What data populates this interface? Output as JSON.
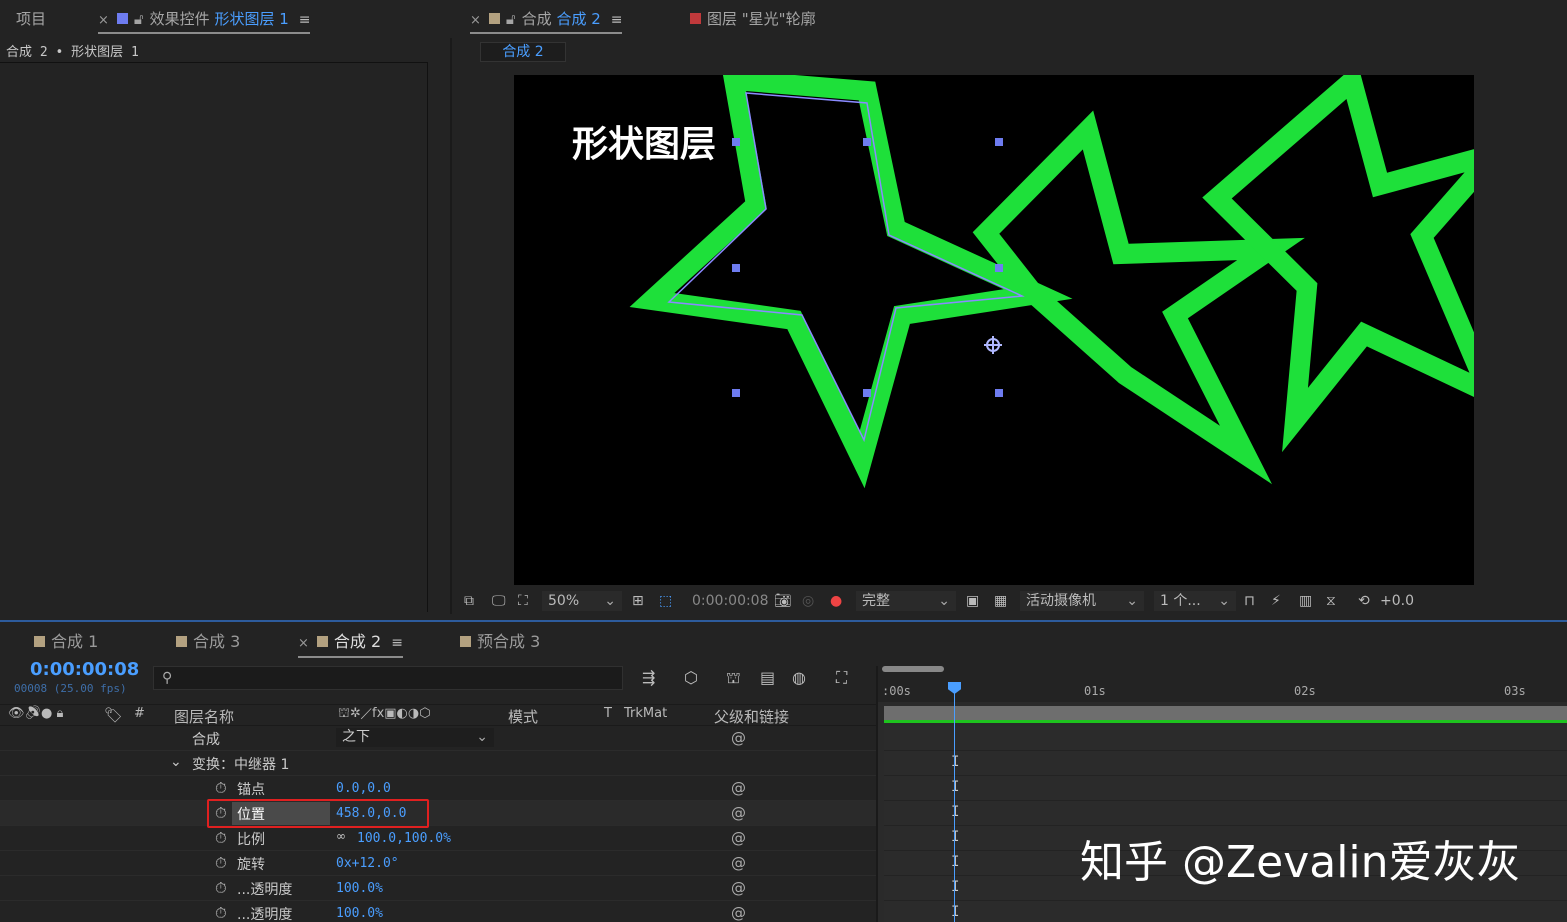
{
  "left_panel": {
    "tab_project": "项目",
    "tab_effects_prefix": "效果控件",
    "tab_effects_layer": "形状图层 1",
    "breadcrumb": "合成 2 • 形状图层 1"
  },
  "comp_panel": {
    "tab_prefix": "合成",
    "tab_comp": "合成 2",
    "tab_layer": "图层 \"星光\"轮廓",
    "subtab": "合成 2",
    "viewer_text": "形状图层"
  },
  "viewer_toolbar": {
    "zoom": "50%",
    "timecode": "0:00:00:08",
    "quality": "完整",
    "camera": "活动摄像机",
    "views": "1 个...",
    "exposure": "+0.0"
  },
  "timeline": {
    "tabs": [
      "合成 1",
      "合成 3",
      "合成 2",
      "预合成 3"
    ],
    "time": "0:00:00:08",
    "frames": "00008 (25.00 fps)",
    "search_placeholder": "",
    "columns": {
      "name": "图层名称",
      "hash": "#",
      "mode": "模式",
      "t": "T",
      "trkmat": "TrkMat",
      "parent": "父级和链接"
    },
    "rows": [
      {
        "label": "合成",
        "value": "之下"
      },
      {
        "label": "变换：中继器 1",
        "value": ""
      },
      {
        "label": "锚点",
        "value": "0.0,0.0"
      },
      {
        "label": "位置",
        "value": "458.0,0.0"
      },
      {
        "label": "比例",
        "value": "100.0,100.0%"
      },
      {
        "label": "旋转",
        "value": "0x+12.0°"
      },
      {
        "label": "...透明度",
        "value": "100.0%"
      },
      {
        "label": "...透明度",
        "value": "100.0%"
      }
    ],
    "ruler": [
      ":00s",
      "01s",
      "02s",
      "03s"
    ]
  },
  "watermark": "知乎 @Zevalin爱灰灰",
  "colors": {
    "accent": "#4a9eff",
    "star": "#1ee03a",
    "highlight_box": "#e02020"
  }
}
